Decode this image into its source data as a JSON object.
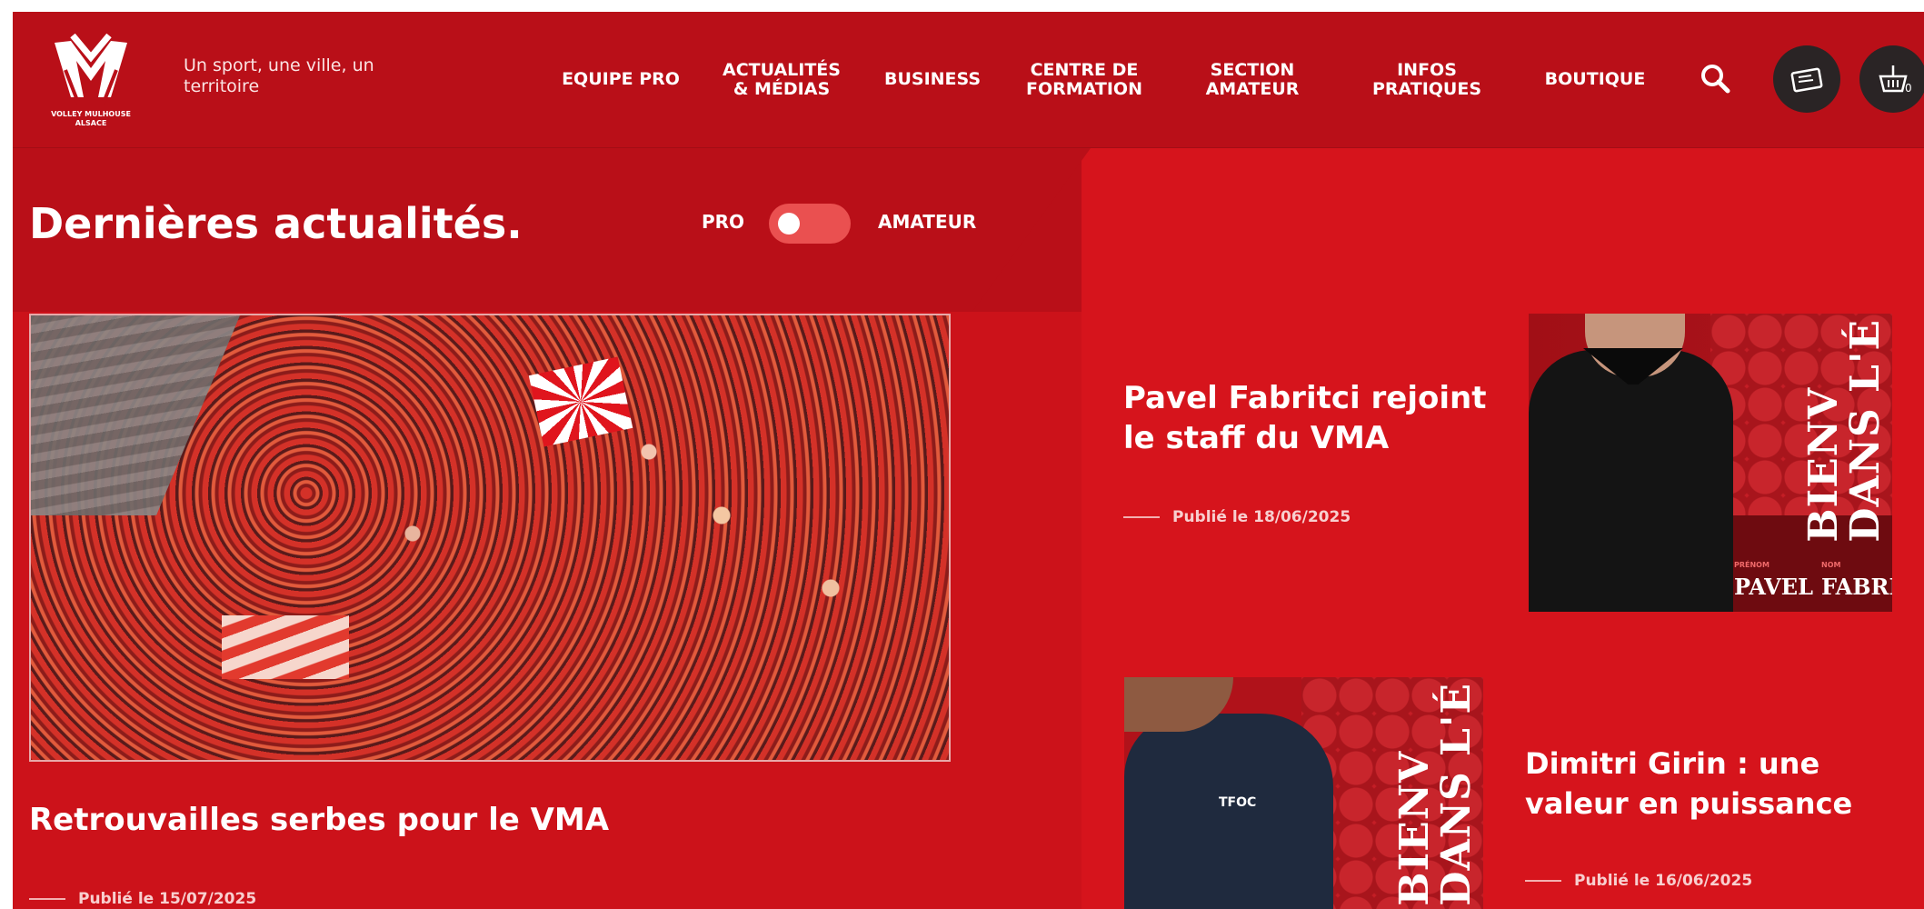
{
  "header": {
    "logo_text": "VOLLEY MULHOUSE ALSACE",
    "tagline": "Un sport, une ville, un territoire",
    "nav": [
      {
        "id": "equipe-pro",
        "label": "EQUIPE PRO"
      },
      {
        "id": "actualites",
        "label": "ACTUALITÉS\n& MÉDIAS"
      },
      {
        "id": "business",
        "label": "BUSINESS"
      },
      {
        "id": "centre-formation",
        "label": "CENTRE DE\nFORMATION"
      },
      {
        "id": "section-amateur",
        "label": "SECTION\nAMATEUR"
      },
      {
        "id": "infos-pratiques",
        "label": "INFOS\nPRATIQUES"
      },
      {
        "id": "boutique",
        "label": "BOUTIQUE"
      }
    ],
    "icons": [
      "search-icon",
      "ticket-icon",
      "basket-icon"
    ],
    "cart_count": "0"
  },
  "section": {
    "title": "Dernières actualités.",
    "toggle_left": "PRO",
    "toggle_right": "AMATEUR",
    "toggle_selected": "PRO"
  },
  "articles": [
    {
      "title": "Retrouvailles serbes pour le VMA",
      "date": "Publié le 15/07/2025"
    },
    {
      "title": "Pavel Fabritci rejoint le staff du VMA",
      "date": "Publié le 18/06/2025"
    },
    {
      "title": "Dimitri Girin : une valeur en puissance",
      "date": "Publié le 16/06/2025"
    }
  ],
  "image_text": {
    "welcome": "BIENV\nDANS L'É",
    "prenom_label": "PRÉNOM",
    "nom_label": "NOM",
    "pavel_first": "PAVEL",
    "pavel_last": "FABRITC",
    "dimitri_logo": "TFOC"
  },
  "colors": {
    "primary": "#cc121a",
    "header": "#b90f18",
    "dark_button": "#2a2425"
  }
}
